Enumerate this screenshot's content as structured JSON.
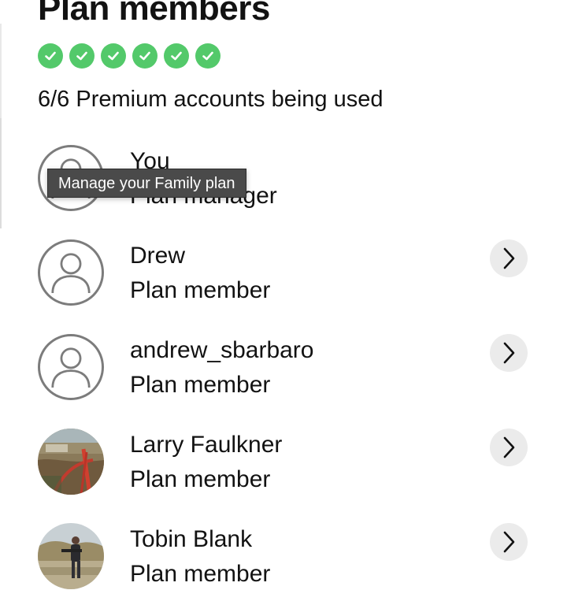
{
  "header": {
    "title": "Plan members",
    "slots_used": 6,
    "slots_total": 6,
    "usage_text": "6/6 Premium accounts being used"
  },
  "members": [
    {
      "name": "You",
      "role": "Plan manager",
      "avatar": "default-user-icon"
    },
    {
      "name": "Drew",
      "role": "Plan member",
      "avatar": "default-user-icon"
    },
    {
      "name": "andrew_sbarbaro",
      "role": "Plan member",
      "avatar": "default-user-icon"
    },
    {
      "name": "Larry Faulkner",
      "role": "Plan member",
      "avatar": "photo"
    },
    {
      "name": "Tobin Blank",
      "role": "Plan member",
      "avatar": "photo"
    }
  ],
  "tooltip": {
    "text": "Manage your Family plan"
  },
  "colors": {
    "check_green": "#53c96a",
    "chevron_bg": "#ebebeb",
    "tooltip_bg": "#4a4a4a"
  }
}
